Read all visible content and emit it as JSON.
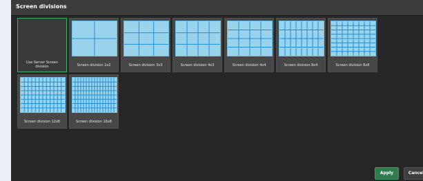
{
  "dialog": {
    "title": "Screen divisions"
  },
  "tiles": [
    {
      "label": "Use Server Screen division",
      "cols": 0,
      "rows": 0,
      "selected": true
    },
    {
      "label": "Screen division 2x2",
      "cols": 2,
      "rows": 2,
      "selected": false
    },
    {
      "label": "Screen division 3x3",
      "cols": 3,
      "rows": 3,
      "selected": false
    },
    {
      "label": "Screen division 4x3",
      "cols": 4,
      "rows": 3,
      "selected": false
    },
    {
      "label": "Screen division 4x4",
      "cols": 4,
      "rows": 4,
      "selected": false
    },
    {
      "label": "Screen division 8x4",
      "cols": 8,
      "rows": 4,
      "selected": false
    },
    {
      "label": "Screen division 8x8",
      "cols": 8,
      "rows": 8,
      "selected": false
    },
    {
      "label": "Screen division 12x8",
      "cols": 12,
      "rows": 8,
      "selected": false
    },
    {
      "label": "Screen division 16x8",
      "cols": 16,
      "rows": 8,
      "selected": false
    }
  ],
  "buttons": {
    "apply": "Apply",
    "cancel": "Cancel"
  },
  "colors": {
    "selected_border": "#3fae68",
    "grid_fill": "#9ad3ec",
    "grid_line": "#1f8fd6",
    "apply_bg": "#2f7d4e"
  }
}
